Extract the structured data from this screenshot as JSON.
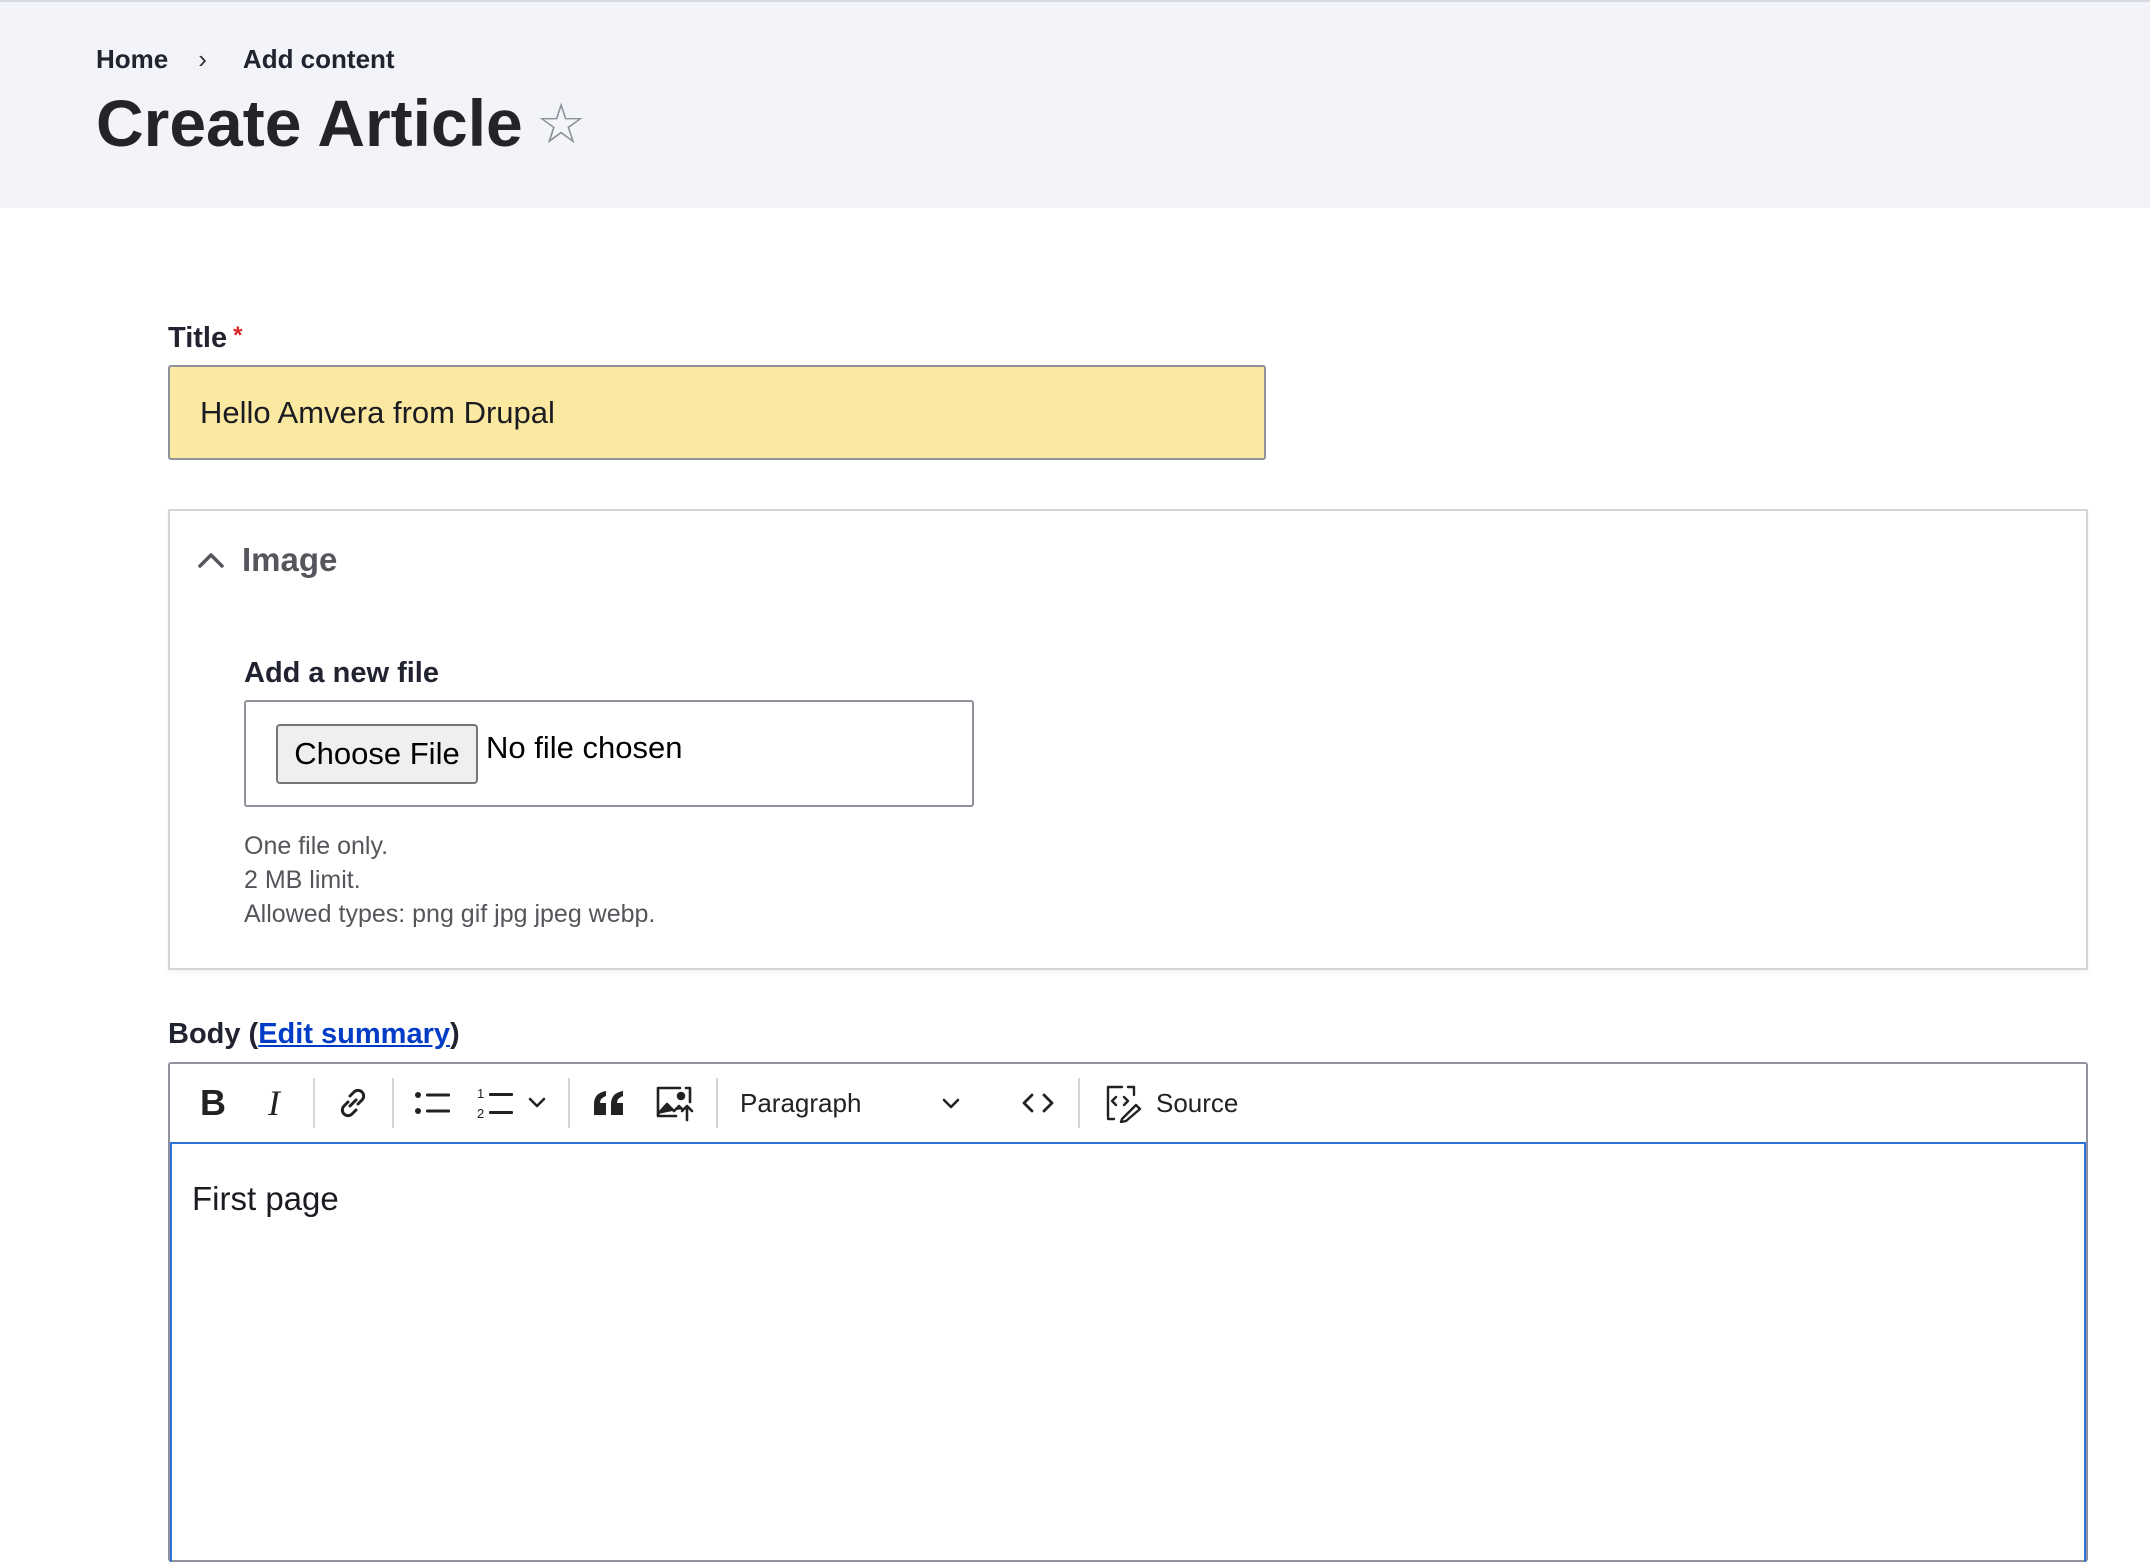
{
  "breadcrumb": {
    "home": "Home",
    "separator": "›",
    "current": "Add content"
  },
  "page": {
    "title": "Create Article",
    "favorite_icon": "star-outline-icon"
  },
  "title_field": {
    "label": "Title",
    "required_marker": "*",
    "value": "Hello Amvera from Drupal"
  },
  "image_panel": {
    "title": "Image",
    "file_label": "Add a new file",
    "choose_button": "Choose File",
    "file_status": "No file chosen",
    "help": [
      "One file only.",
      "2 MB limit.",
      "Allowed types: png gif jpg jpeg webp."
    ]
  },
  "body_field": {
    "label_prefix": "Body (",
    "edit_summary_link": "Edit summary",
    "label_suffix": ")",
    "toolbar": {
      "format_select": "Paragraph",
      "source_label": "Source",
      "icons": [
        "bold-icon",
        "italic-icon",
        "link-icon",
        "bulleted-list-icon",
        "numbered-list-icon",
        "chevron-down-icon",
        "blockquote-icon",
        "image-upload-icon",
        "chevron-down-icon",
        "code-block-icon",
        "source-edit-icon"
      ]
    },
    "content": "First page"
  },
  "colors": {
    "header_bg": "#f3f4f9",
    "title_input_bg": "#fbe9a2",
    "link": "#003cc5",
    "required": "#dc2323",
    "editor_focus": "#2f74d8"
  }
}
